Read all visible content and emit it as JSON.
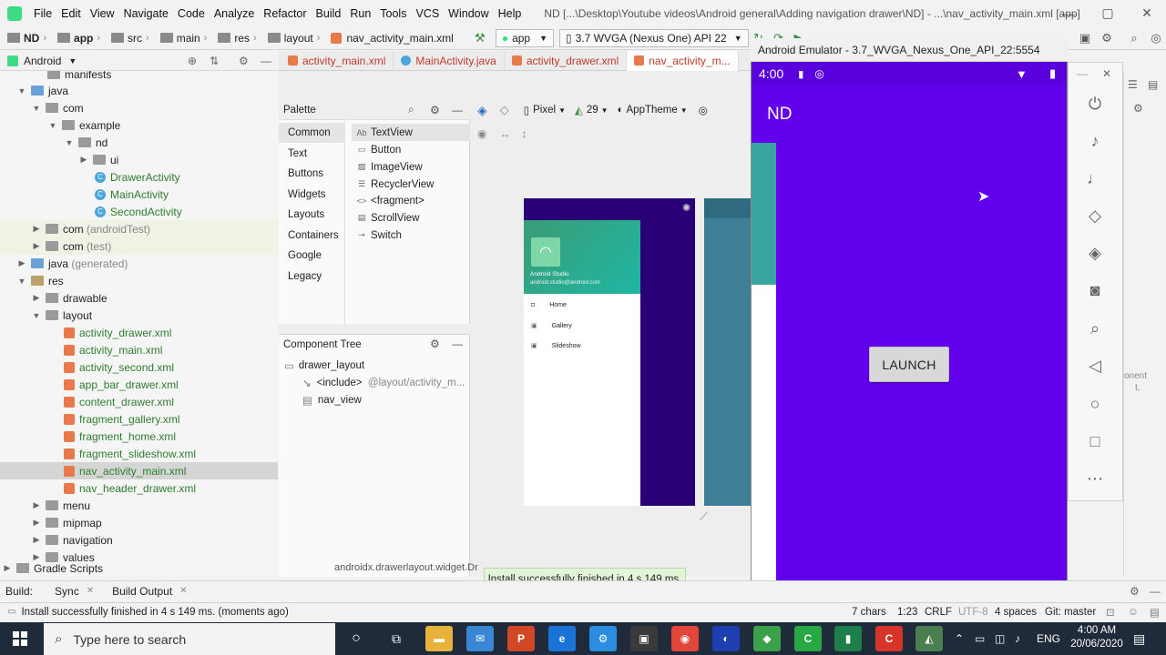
{
  "menubar": {
    "items": [
      "File",
      "Edit",
      "View",
      "Navigate",
      "Code",
      "Analyze",
      "Refactor",
      "Build",
      "Run",
      "Tools",
      "VCS",
      "Window",
      "Help"
    ],
    "window_title": "ND [...\\Desktop\\Youtube videos\\Android general\\Adding navigation drawer\\ND] - ...\\nav_activity_main.xml [app]"
  },
  "toolbar": {
    "crumbs": [
      "ND",
      "app",
      "src",
      "main",
      "res",
      "layout",
      "nav_activity_main.xml"
    ],
    "run_config": "app",
    "device": "3.7 WVGA (Nexus One) API 22"
  },
  "project": {
    "view_mode": "Android",
    "rows": [
      {
        "label": "manifests",
        "indent": 3
      },
      {
        "label": "java",
        "indent": 2
      },
      {
        "label": "com",
        "indent": 3
      },
      {
        "label": "example",
        "indent": 4
      },
      {
        "label": "nd",
        "indent": 5
      },
      {
        "label": "ui",
        "indent": 6
      },
      {
        "label": "DrawerActivity",
        "indent": 6
      },
      {
        "label": "MainActivity",
        "indent": 6
      },
      {
        "label": "SecondActivity",
        "indent": 6
      },
      {
        "label": "com",
        "suffix": "(androidTest)",
        "indent": 3
      },
      {
        "label": "com",
        "suffix": "(test)",
        "indent": 3
      },
      {
        "label": "java",
        "suffix": "(generated)",
        "indent": 2
      },
      {
        "label": "res",
        "indent": 2
      },
      {
        "label": "drawable",
        "indent": 3
      },
      {
        "label": "layout",
        "indent": 3
      },
      {
        "label": "activity_drawer.xml",
        "indent": 4
      },
      {
        "label": "activity_main.xml",
        "indent": 4
      },
      {
        "label": "activity_second.xml",
        "indent": 4
      },
      {
        "label": "app_bar_drawer.xml",
        "indent": 4
      },
      {
        "label": "content_drawer.xml",
        "indent": 4
      },
      {
        "label": "fragment_gallery.xml",
        "indent": 4
      },
      {
        "label": "fragment_home.xml",
        "indent": 4
      },
      {
        "label": "fragment_slideshow.xml",
        "indent": 4
      },
      {
        "label": "nav_activity_main.xml",
        "indent": 4
      },
      {
        "label": "nav_header_drawer.xml",
        "indent": 4
      },
      {
        "label": "menu",
        "indent": 3
      },
      {
        "label": "mipmap",
        "indent": 3
      },
      {
        "label": "navigation",
        "indent": 3
      },
      {
        "label": "values",
        "indent": 3
      },
      {
        "label": "Gradle Scripts",
        "indent": 1
      }
    ]
  },
  "tabs": [
    "activity_main.xml",
    "MainActivity.java",
    "activity_drawer.xml",
    "nav_activity_m..."
  ],
  "palette": {
    "title": "Palette",
    "categories": [
      "Common",
      "Text",
      "Buttons",
      "Widgets",
      "Layouts",
      "Containers",
      "Google",
      "Legacy"
    ],
    "items": [
      "TextView",
      "Button",
      "ImageView",
      "RecyclerView",
      "<fragment>",
      "ScrollView",
      "Switch"
    ],
    "item_prefix": "Ab"
  },
  "design_toolbar": {
    "pixel": "Pixel",
    "api": "29",
    "theme": "AppTheme"
  },
  "component_tree": {
    "title": "Component Tree",
    "root": "drawer_layout",
    "include_label": "<include>",
    "include_value": "@layout/activity_m...",
    "nav_view": "nav_view"
  },
  "preview": {
    "header_title": "Android Studio",
    "header_email": "android.studio@android.com",
    "menu": [
      "Home",
      "Gallery",
      "Slideshow"
    ]
  },
  "breadcrumb_bottom": "androidx.drawerlayout.widget.Dr",
  "emulator": {
    "title": "Android Emulator - 3.7_WVGA_Nexus_One_API_22:5554",
    "time": "4:00",
    "app_title": "ND",
    "button": "LAUNCH"
  },
  "toast": "Install successfully finished in 4 s 149 ms.",
  "buildbar": {
    "build": "Build:",
    "sync": "Sync",
    "output": "Build Output"
  },
  "status": {
    "message": "Install successfully finished in 4 s 149 ms. (moments ago)",
    "chars": "7 chars",
    "pos": "1:23",
    "eol": "CRLF",
    "enc": "UTF-8",
    "indent": "4 spaces",
    "git": "Git: master"
  },
  "taskbar": {
    "search_placeholder": "Type here to search",
    "lang": "ENG",
    "time": "4:00 AM",
    "date": "20/06/2020"
  },
  "right_panel": {
    "text1": "onent",
    "text2": "t."
  }
}
